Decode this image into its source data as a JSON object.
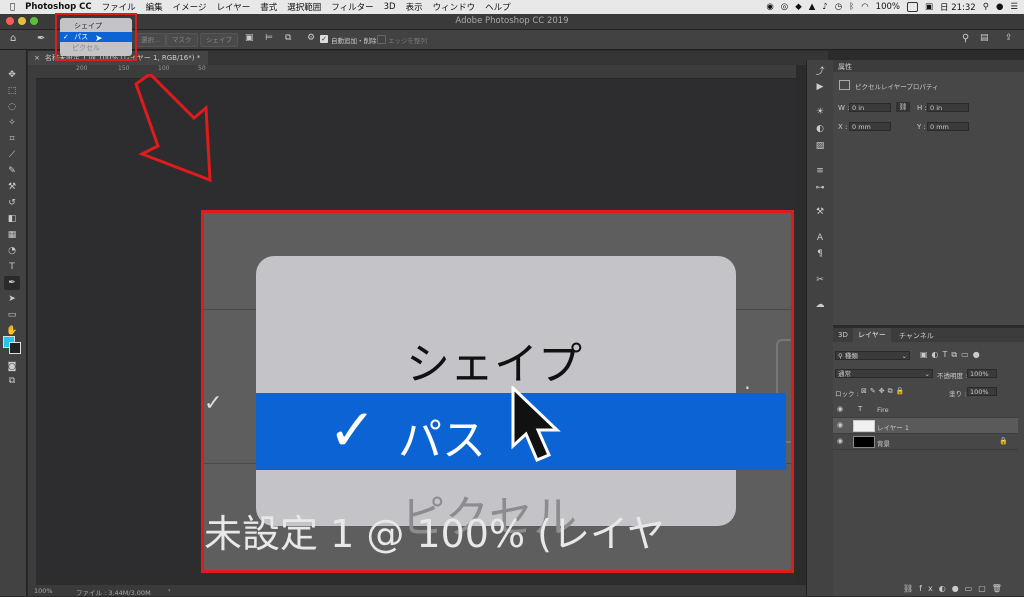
{
  "menubar": {
    "apple": "",
    "app": "Photoshop CC",
    "items": [
      "ファイル",
      "編集",
      "イメージ",
      "レイヤー",
      "書式",
      "選択範囲",
      "フィルター",
      "3D",
      "表示",
      "ウィンドウ",
      "ヘルプ"
    ],
    "battery": "100%",
    "clock": "日 21:32"
  },
  "window": {
    "title": "Adobe Photoshop CC 2019"
  },
  "options": {
    "select_btn": "選択...",
    "mask_btn": "マスク",
    "shape_btn": "シェイプ",
    "auto_add": "自動追加・削除",
    "edge_align": "エッジを整列"
  },
  "doc": {
    "tab": "名称未設定 1 @ 100% (レイヤー 1, RGB/16*) *"
  },
  "ruler": {
    "ticks": [
      "200",
      "150",
      "100",
      "50"
    ]
  },
  "dropdown": {
    "shape": "シェイプ",
    "path": "パス",
    "pixel": "ピクセル",
    "check": "✓"
  },
  "zoom_title": "未設定 1 @ 100% (レイヤ",
  "properties": {
    "tab": "属性",
    "title": "ピクセルレイヤープロパティ",
    "w_label": "W :",
    "w_val": "0 in",
    "h_label": "H :",
    "h_val": "0 in",
    "x_label": "X :",
    "x_val": "0 mm",
    "y_label": "Y :",
    "y_val": "0 mm"
  },
  "layers": {
    "tabs": [
      "3D",
      "レイヤー",
      "チャンネル"
    ],
    "kind": "種類",
    "blend": "通常",
    "opacity_label": "不透明度 :",
    "opacity": "100%",
    "lock_label": "ロック :",
    "fill_label": "塗り :",
    "fill": "100%",
    "items": [
      {
        "name": "Fire",
        "type": "T"
      },
      {
        "name": "レイヤー 1",
        "type": "pixel"
      },
      {
        "name": "背景",
        "type": "bg"
      }
    ]
  },
  "status": {
    "zoom": "100%",
    "file": "ファイル : 3.44M/3.00M"
  },
  "colors": {
    "accent": "#0c63d4",
    "highlight": "#e01b1b",
    "foreground": "#1ec8f0"
  }
}
